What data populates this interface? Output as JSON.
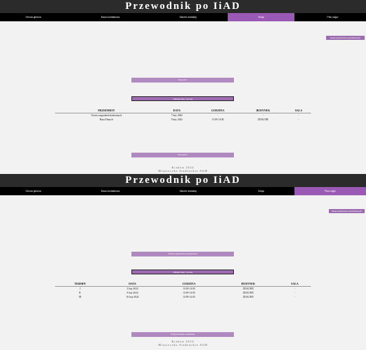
{
  "header": {
    "title": "Przewodnik po IiAD"
  },
  "nav_a": [
    "Strona główna",
    "Baza kontaktowa",
    "Ważne kontakty",
    "Sesja",
    "Plan zajęć"
  ],
  "nav_b": [
    "Strona główna",
    "Baza kontaktowa",
    "Ważne kontakty",
    "Sesja",
    "Plan zajęć"
  ],
  "side_button": "Sesja egzaminów poprawkowych",
  "screen_a": {
    "section_bar": "Semestr I",
    "bar_bordered": "Odbądź daty, rozmiaj",
    "table": {
      "headers": [
        "PRZEDMIOT",
        "DATA",
        "GODZINA",
        "BUDYNEK",
        "SALA"
      ],
      "rows": [
        [
          "Teoria rozgradzeń dyskretnych",
          "7 luty 2024",
          "-",
          "-",
          "-"
        ],
        [
          "Bazy Danych",
          "9 luty 2024",
          "11:00-14:30",
          "ZDALNIE",
          "-"
        ]
      ]
    },
    "bottom_bar": "Semestr II"
  },
  "screen_b": {
    "section_bar": "Termin egzaminów dyskretnych",
    "bar_bordered": "Odbądź daty, rozmiaj",
    "table": {
      "headers": [
        "TERMIN",
        "DATA",
        "GODZINA",
        "BUDYNEK",
        "SALA"
      ],
      "rows": [
        [
          "I",
          "2 luty 2024",
          "11:00-14:30",
          "ZDALNIE",
          "-"
        ],
        [
          "II",
          "9 luty 2024",
          "11:00-14:30",
          "ZDALNIE",
          "-"
        ],
        [
          "III",
          "16 luty 2024",
          "11:00-14:30",
          "ZDALNIE",
          "-"
        ]
      ]
    },
    "bottom_bar": "Programowanie obiektowe"
  },
  "footer": {
    "line1": "Kraków 2024",
    "line2": "Miasteczko Studenckie AGH"
  }
}
